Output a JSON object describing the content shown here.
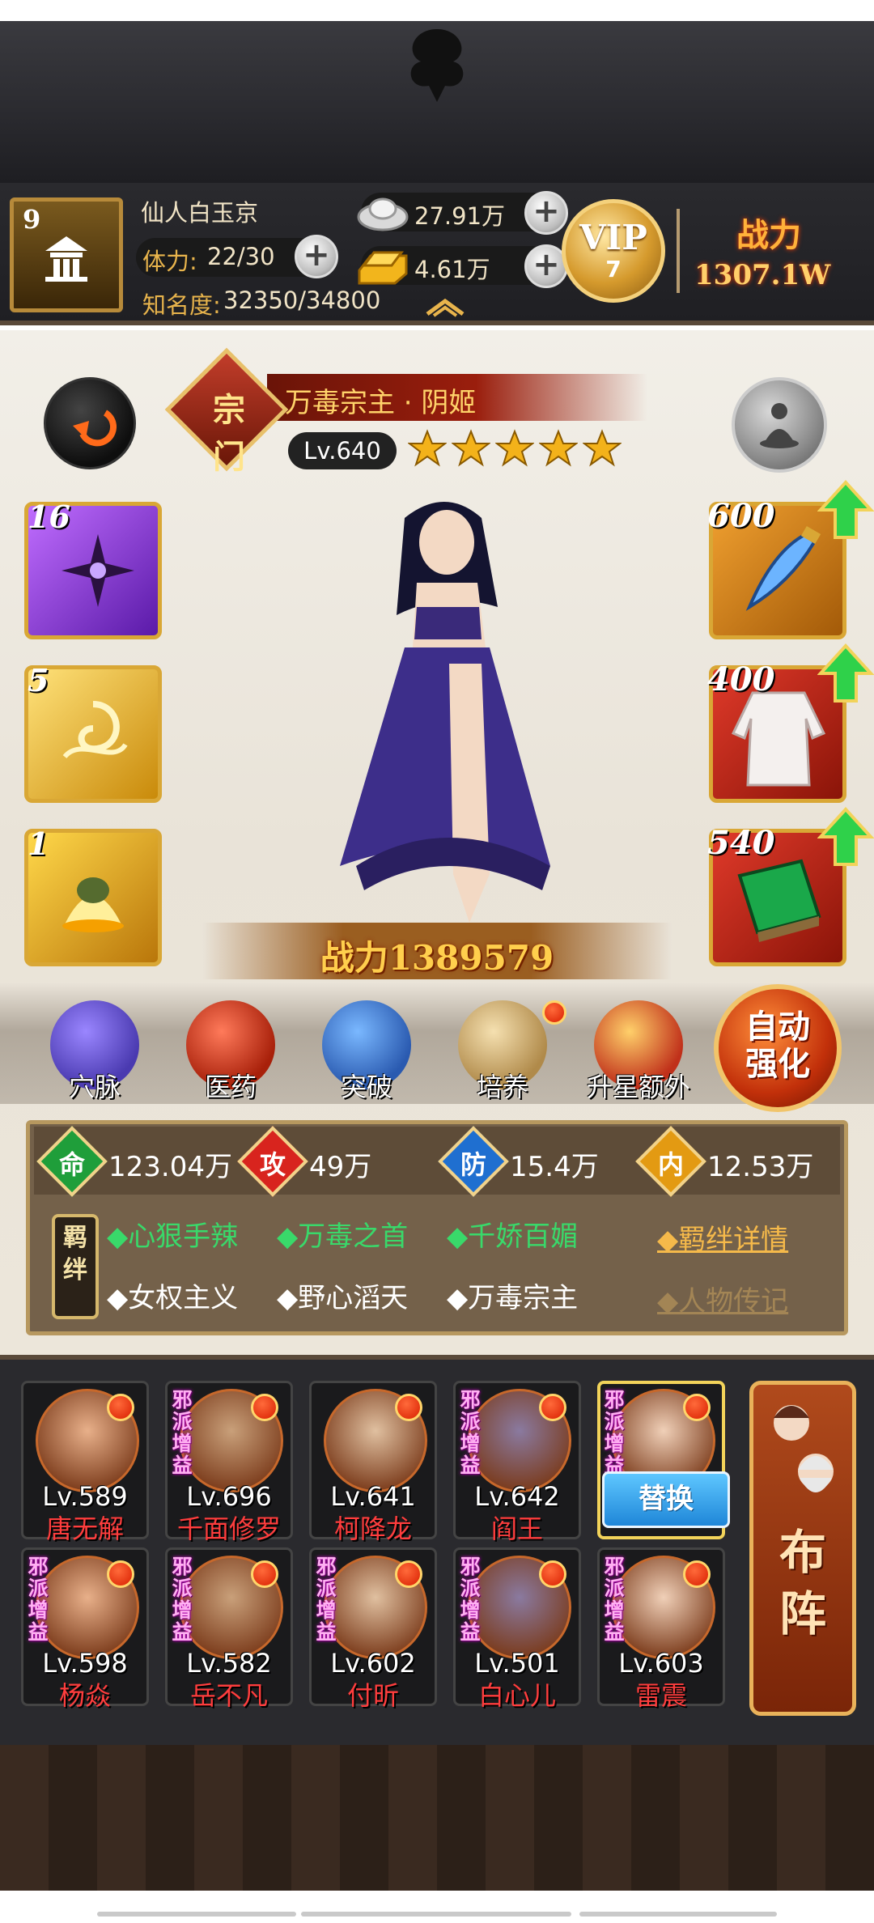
{
  "player": {
    "level": "9",
    "name": "仙人白玉京",
    "stamina_label": "体力:",
    "stamina_value": "22/30",
    "fame_label": "知名度:",
    "fame_value": "32350/34800",
    "silver": "27.91万",
    "gold": "4.61万",
    "vip_text": "VIP",
    "vip_level": "7",
    "power_label": "战力",
    "power_value": "1307.1W"
  },
  "hero": {
    "sect_badge": "宗门",
    "name": "万毒宗主 · 阴姬",
    "level": "Lv.640",
    "stars": 5,
    "combat_power": "战力1389579"
  },
  "skills": [
    {
      "level": "16",
      "color": "#8a2bd8"
    },
    {
      "level": "5",
      "color": "#e0a81c"
    },
    {
      "level": "1",
      "color": "#e0a81c"
    }
  ],
  "equipment": [
    {
      "level": "600",
      "name": "weapon"
    },
    {
      "level": "400",
      "name": "robe"
    },
    {
      "level": "540",
      "name": "book"
    }
  ],
  "functions": [
    {
      "label": "穴脉",
      "icon": "meridian-icon",
      "has_dot": false
    },
    {
      "label": "医药",
      "icon": "medicine-icon",
      "has_dot": false
    },
    {
      "label": "突破",
      "icon": "breakthrough-icon",
      "has_dot": false
    },
    {
      "label": "培养",
      "icon": "cultivate-icon",
      "has_dot": true
    },
    {
      "label": "升星额外",
      "icon": "star-up-icon",
      "has_dot": false
    }
  ],
  "auto_enhance": {
    "line1": "自动",
    "line2": "强化"
  },
  "stats": [
    {
      "char": "命",
      "value": "123.04万",
      "color": "#1f9e3a"
    },
    {
      "char": "攻",
      "value": "49万",
      "color": "#d8241e"
    },
    {
      "char": "防",
      "value": "15.4万",
      "color": "#1f6fd0"
    },
    {
      "char": "内",
      "value": "12.53万",
      "color": "#e39a12"
    }
  ],
  "bonds": {
    "tag": "羁绊",
    "active": [
      "◆心狠手辣",
      "◆万毒之首",
      "◆千娇百媚"
    ],
    "inactive": [
      "◆女权主义",
      "◆野心滔天",
      "◆万毒宗主"
    ],
    "details_link": "◆羁绊详情",
    "biography_link": "◆人物传记"
  },
  "roster": {
    "sect_boost": "邪派增益",
    "row1": [
      {
        "level": "Lv.589",
        "name": "唐无解",
        "boost": false
      },
      {
        "level": "Lv.696",
        "name": "千面修罗",
        "boost": true
      },
      {
        "level": "Lv.641",
        "name": "柯降龙",
        "boost": false
      },
      {
        "level": "Lv.642",
        "name": "阎王",
        "boost": true
      },
      {
        "level": "",
        "name": "",
        "boost": true,
        "selected": true
      }
    ],
    "row2": [
      {
        "level": "Lv.598",
        "name": "杨焱",
        "boost": true
      },
      {
        "level": "Lv.582",
        "name": "岳不凡",
        "boost": true
      },
      {
        "level": "Lv.602",
        "name": "付昕",
        "boost": true
      },
      {
        "level": "Lv.501",
        "name": "白心儿",
        "boost": true
      },
      {
        "level": "Lv.603",
        "name": "雷震",
        "boost": true
      }
    ],
    "swap_label": "替换",
    "formation_label": "布阵"
  }
}
